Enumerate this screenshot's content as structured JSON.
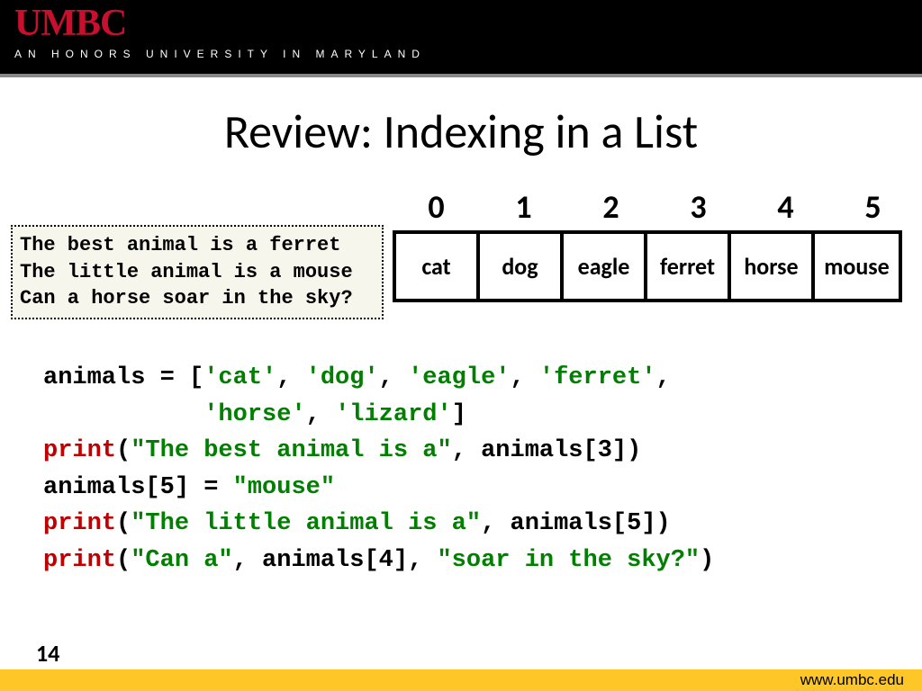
{
  "header": {
    "logo": "UMBC",
    "tagline": "AN HONORS UNIVERSITY IN MARYLAND"
  },
  "title": "Review: Indexing in a List",
  "output": {
    "line1": "The best animal is a ferret",
    "line2": "The little animal is a mouse",
    "line3": "Can a horse soar in the sky?"
  },
  "indices": [
    "0",
    "1",
    "2",
    "3",
    "4",
    "5"
  ],
  "cells": [
    "cat",
    "dog",
    "eagle",
    "ferret",
    "horse",
    "mouse"
  ],
  "code": {
    "assign_pre": "animals = [",
    "s0": "'cat'",
    "c": ", ",
    "s1": "'dog'",
    "s2": "'eagle'",
    "s3": "'ferret'",
    "s4": "'horse'",
    "s5": "'lizard'",
    "assign_post": "]",
    "print_kw": "print",
    "p1_open": "(",
    "p1_str": "\"The best animal is a\"",
    "p1_rest": ", animals[3])",
    "mutate": "animals[5] = ",
    "mutate_str": "\"mouse\"",
    "p2_str": "\"The little animal is a\"",
    "p2_rest": ", animals[5])",
    "p3_str1": "\"Can a\"",
    "p3_mid": ", animals[4], ",
    "p3_str2": "\"soar in the sky?\"",
    "p3_close": ")"
  },
  "page_number": "14",
  "footer_url": "www.umbc.edu"
}
